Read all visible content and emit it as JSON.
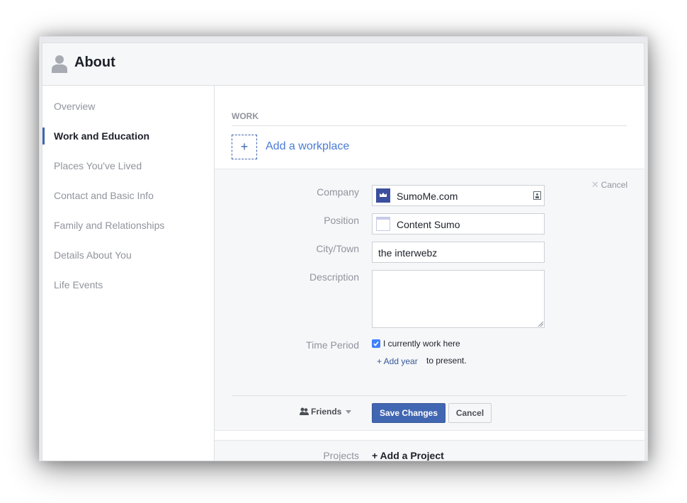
{
  "header": {
    "title": "About",
    "icon": "person-silhouette-icon"
  },
  "sidebar": {
    "items": [
      {
        "label": "Overview",
        "active": false
      },
      {
        "label": "Work and Education",
        "active": true
      },
      {
        "label": "Places You've Lived",
        "active": false
      },
      {
        "label": "Contact and Basic Info",
        "active": false
      },
      {
        "label": "Family and Relationships",
        "active": false
      },
      {
        "label": "Details About You",
        "active": false
      },
      {
        "label": "Life Events",
        "active": false
      }
    ]
  },
  "work": {
    "section_title": "WORK",
    "add_icon": "+",
    "add_label": "Add a workplace"
  },
  "form": {
    "cancel_label": "Cancel",
    "cancel_icon": "✕",
    "company": {
      "label": "Company",
      "value": "SumoMe.com"
    },
    "position": {
      "label": "Position",
      "value": "Content Sumo"
    },
    "city": {
      "label": "City/Town",
      "value": "the interwebz"
    },
    "description": {
      "label": "Description",
      "value": ""
    },
    "time_period": {
      "label": "Time Period",
      "current_label": "I currently work here",
      "current_checked": true,
      "add_year_label": "+ Add year",
      "to_present": "to present."
    },
    "privacy_label": "Friends",
    "save_label": "Save Changes",
    "cancel_button_label": "Cancel"
  },
  "projects": {
    "label": "Projects",
    "add_label": "+ Add a Project"
  },
  "colors": {
    "accent": "#4267b2",
    "link": "#4b7bd6",
    "muted": "#90949c",
    "panel": "#f6f7f9"
  }
}
